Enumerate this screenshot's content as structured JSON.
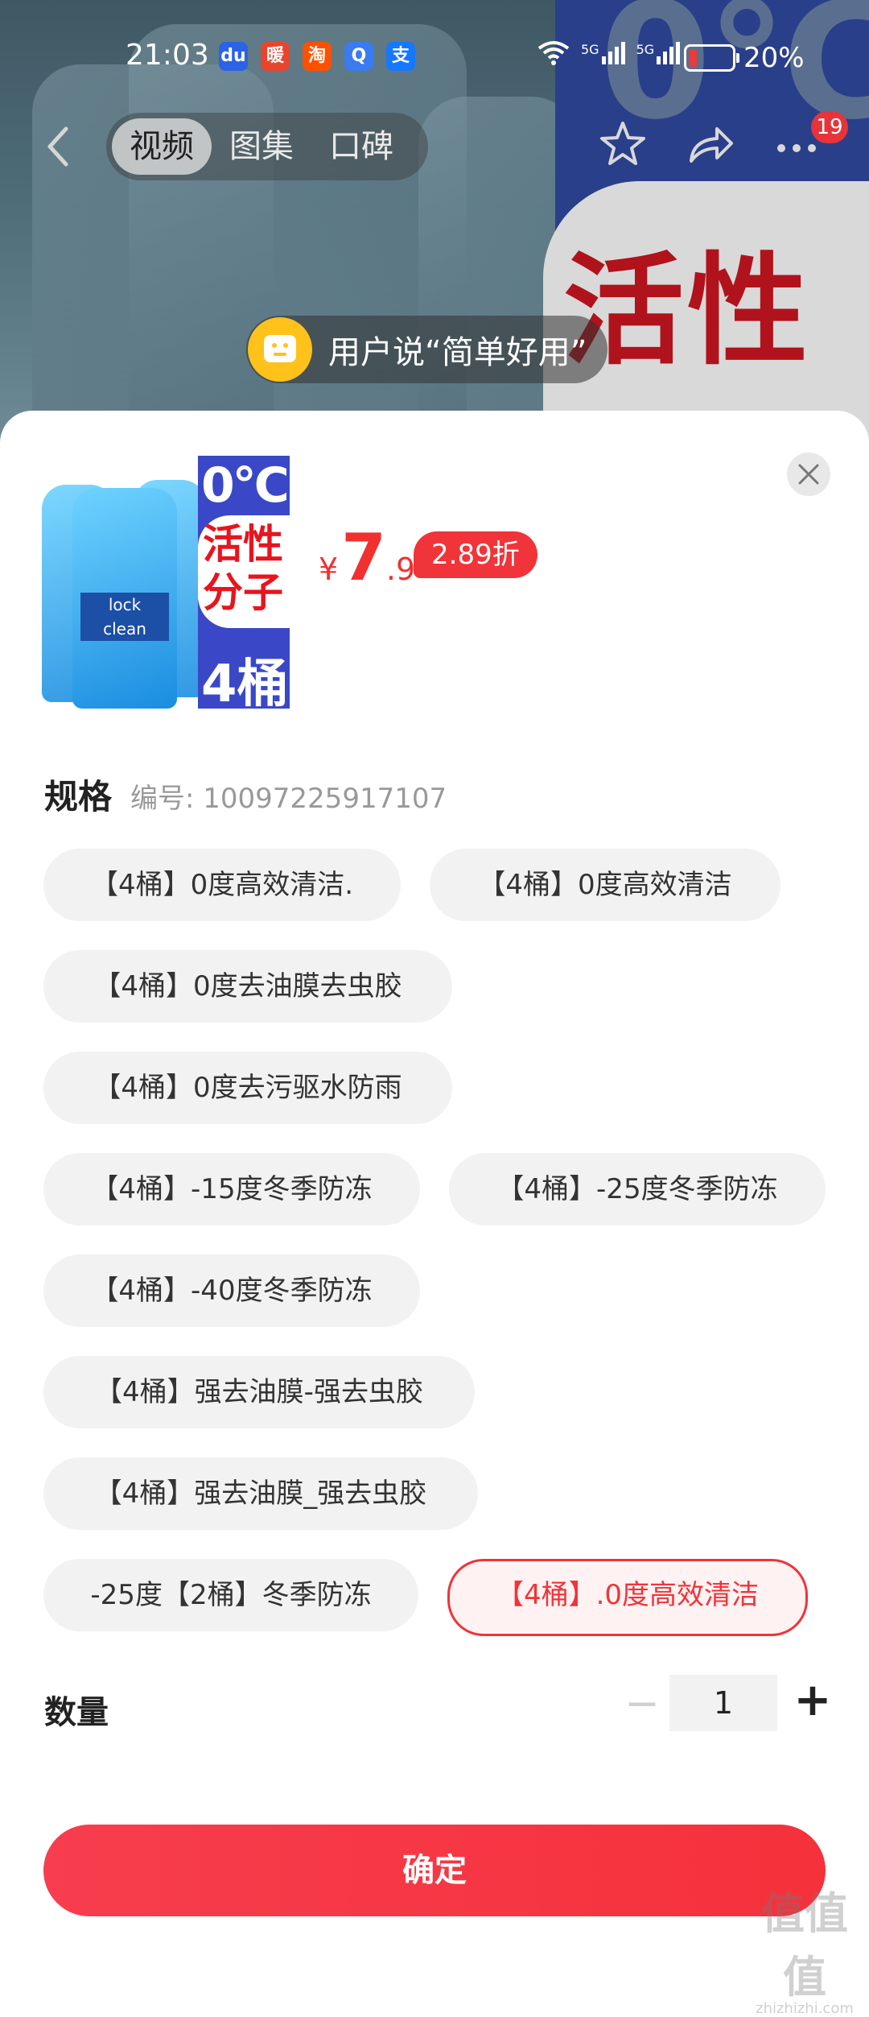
{
  "status_bar": {
    "time": "21:03",
    "battery_percent": "20%",
    "battery_level": 0.2,
    "network": [
      "5G",
      "5G"
    ],
    "app_icons": [
      "baidu-icon",
      "nuan-icon",
      "taobao-icon",
      "search-app-icon",
      "alipay-icon"
    ],
    "app_glyphs": [
      "du",
      "暖",
      "淘",
      "Q",
      "支"
    ]
  },
  "header": {
    "tabs": [
      "视频",
      "图集",
      "口碑"
    ],
    "active_tab": "视频",
    "badge_count": "19"
  },
  "banner": {
    "big_text": "0°C",
    "red_text": "活性"
  },
  "user_says": "用户说“简单好用”",
  "product": {
    "image_text": {
      "temp": "0°C",
      "tagline": "活性\n分子",
      "count": "4桶"
    },
    "currency": "¥",
    "price_int": "7",
    "price_dec": ".9",
    "discount": "2.89折"
  },
  "spec": {
    "title": "规格",
    "id_text": "编号: 10097225917107",
    "options": [
      "【4桶】0度高效清洁.",
      "【4桶】0度高效清洁",
      "【4桶】0度去油膜去虫胶",
      "【4桶】0度去污驱水防雨",
      "【4桶】-15度冬季防冻",
      "【4桶】-25度冬季防冻",
      "【4桶】-40度冬季防冻",
      "【4桶】强去油膜-强去虫胶",
      "【4桶】强去油膜_强去虫胶",
      "-25度【2桶】冬季防冻",
      "【4桶】.0度高效清洁"
    ],
    "selected_index": 10
  },
  "quantity": {
    "label": "数量",
    "minus": "−",
    "value": "1",
    "plus": "+"
  },
  "confirm_label": "确定",
  "watermark": {
    "main": "值值值",
    "sub": "zhizhizhi.com"
  },
  "colors": {
    "accent": "#f0343a",
    "chip_bg": "#f2f2f2"
  }
}
